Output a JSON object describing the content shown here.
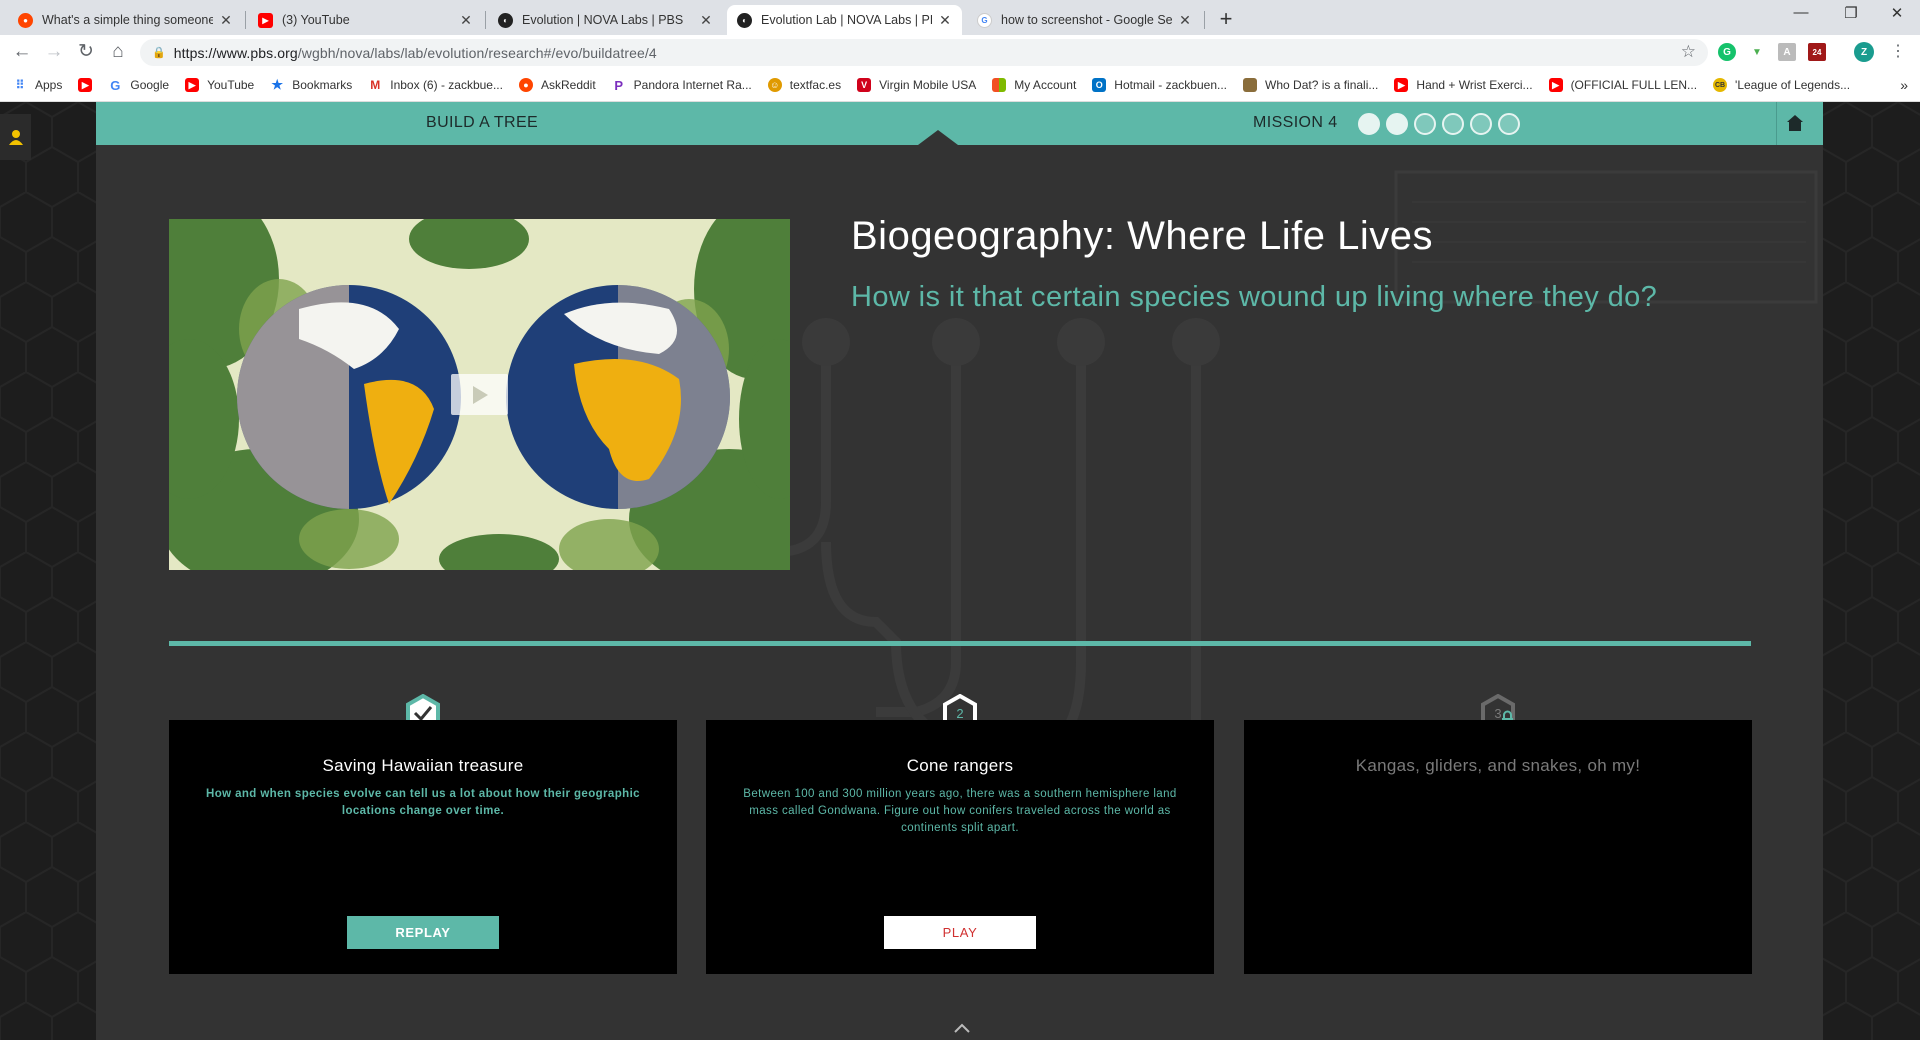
{
  "browser": {
    "tabs": [
      {
        "title": "What's a simple thing someone c",
        "icon": "reddit-icon",
        "color": "#ff4500",
        "active": false
      },
      {
        "title": "(3) YouTube",
        "icon": "youtube-icon",
        "color": "#ff0000",
        "active": false
      },
      {
        "title": "Evolution | NOVA Labs | PBS",
        "icon": "pbs-icon",
        "color": "#222222",
        "active": false
      },
      {
        "title": "Evolution Lab | NOVA Labs | PBS",
        "icon": "pbs-icon",
        "color": "#222222",
        "active": true
      },
      {
        "title": "how to screenshot - Google Sear",
        "icon": "google-icon",
        "color": "#4285f4",
        "active": false
      }
    ],
    "url": "https://www.pbs.org/wgbh/nova/labs/lab/evolution/research#/evo/buildatree/4",
    "url_host": "https://www.pbs.org",
    "url_path": "/wgbh/nova/labs/lab/evolution/research#/evo/buildatree/4",
    "profile_initial": "Z",
    "extension_badge": "24",
    "bookmarks": [
      {
        "label": "Apps",
        "icon": "apps-grid-icon",
        "color": "#4285f4"
      },
      {
        "label": "",
        "icon": "youtube-icon",
        "color": "#ff0000"
      },
      {
        "label": "Google",
        "icon": "google-icon",
        "color": "#4285f4"
      },
      {
        "label": "YouTube",
        "icon": "youtube-icon",
        "color": "#ff0000"
      },
      {
        "label": "Bookmarks",
        "icon": "star-icon",
        "color": "#1a73e8"
      },
      {
        "label": "Inbox (6) - zackbue...",
        "icon": "gmail-icon",
        "color": "#d93025"
      },
      {
        "label": "AskReddit",
        "icon": "reddit-icon",
        "color": "#ff4500"
      },
      {
        "label": "Pandora Internet Ra...",
        "icon": "pandora-icon",
        "color": "#7b2fbe"
      },
      {
        "label": "textfac.es",
        "icon": "face-icon",
        "color": "#e09a00"
      },
      {
        "label": "Virgin Mobile USA",
        "icon": "virgin-icon",
        "color": "#d0021b"
      },
      {
        "label": "My Account",
        "icon": "microsoft-icon",
        "color": "#7fba00"
      },
      {
        "label": "Hotmail - zackbuen...",
        "icon": "outlook-icon",
        "color": "#0072c6"
      },
      {
        "label": "Who Dat? is a finali...",
        "icon": "image-icon",
        "color": "#8a6d3b"
      },
      {
        "label": "Hand + Wrist Exerci...",
        "icon": "youtube-icon",
        "color": "#ff0000"
      },
      {
        "label": "(OFFICIAL FULL LEN...",
        "icon": "youtube-icon",
        "color": "#ff0000"
      },
      {
        "label": "'League of Legends...",
        "icon": "cb-icon",
        "color": "#e5b800"
      }
    ]
  },
  "mission_bar": {
    "title": "BUILD A TREE",
    "mission_label": "MISSION 4",
    "progress_completed": 2,
    "progress_total": 6
  },
  "lesson": {
    "title": "Biogeography: Where Life Lives",
    "subtitle": "How is it that certain species wound up living where they do?"
  },
  "cards": [
    {
      "status": "completed",
      "badge": "✓",
      "title": "Saving Hawaiian treasure",
      "description": "How and when species evolve can tell us a lot about how their geographic locations change over time.",
      "button": "REPLAY"
    },
    {
      "status": "current",
      "badge": "2",
      "title": "Cone rangers",
      "description": "Between 100 and 300 million years ago, there was a southern hemisphere land mass called Gondwana. Figure out how conifers traveled across the world as continents split apart.",
      "button": "PLAY"
    },
    {
      "status": "locked",
      "badge": "3",
      "title": "Kangas, gliders, and snakes, oh my!",
      "description": "",
      "button": ""
    }
  ],
  "colors": {
    "accent": "#5db8a8",
    "panel": "#333333",
    "card": "#000000",
    "play_text": "#d03030"
  }
}
